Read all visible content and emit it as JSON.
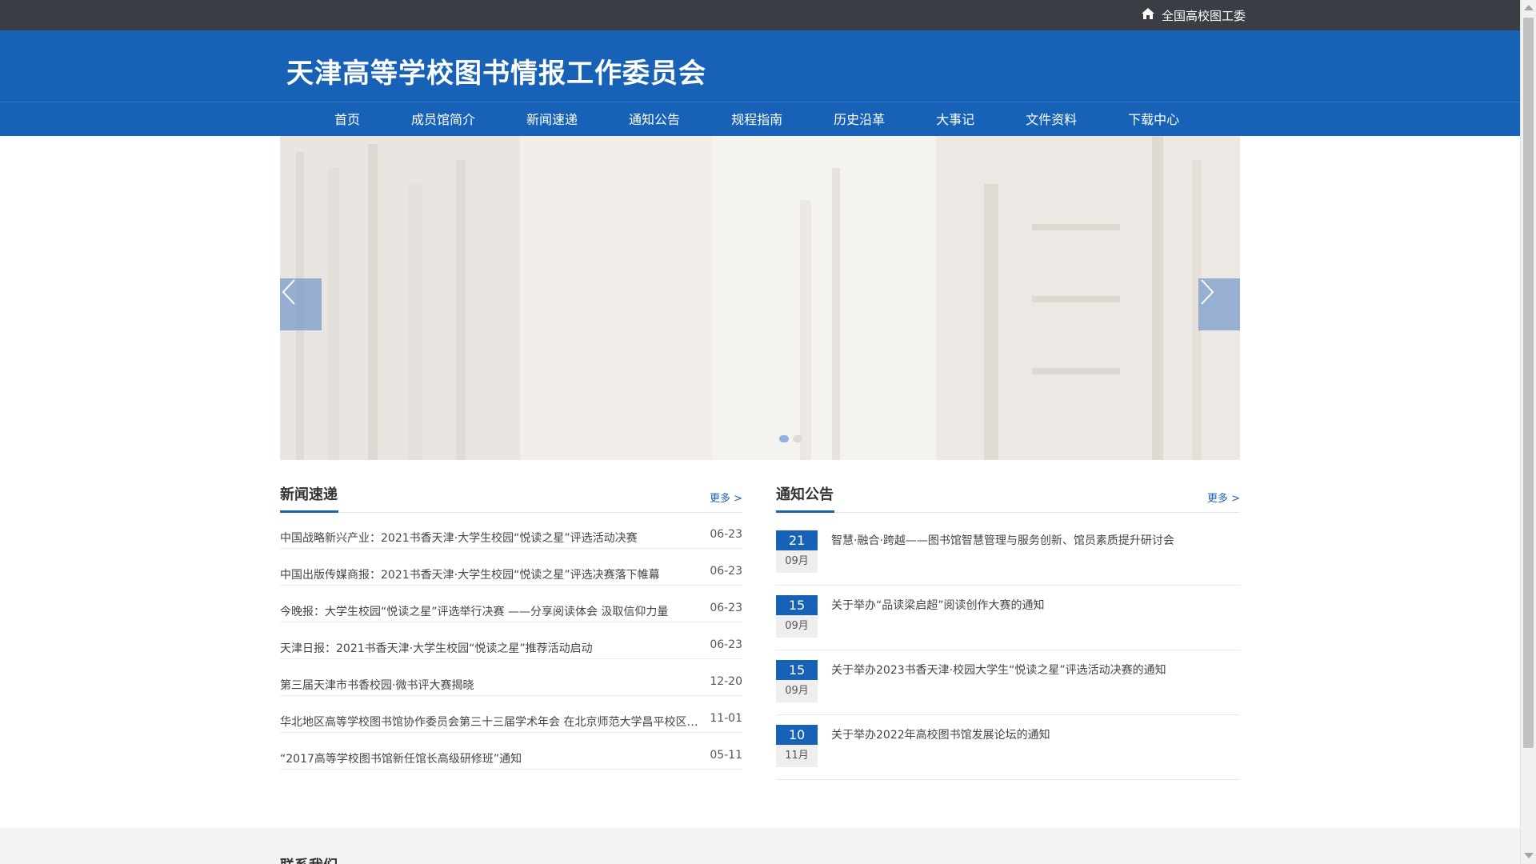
{
  "topbar": {
    "link_label": "全国高校图工委",
    "icon": "home-icon"
  },
  "header": {
    "site_title": "天津高等学校图书情报工作委员会"
  },
  "nav": {
    "items": [
      "首页",
      "成员馆简介",
      "新闻速递",
      "通知公告",
      "规程指南",
      "历史沿革",
      "大事记",
      "文件资料",
      "下载中心"
    ]
  },
  "banner": {
    "slide_count": 2,
    "active_index": 0,
    "prev_icon": "chevron-left-icon",
    "next_icon": "chevron-right-icon"
  },
  "news": {
    "title": "新闻速递",
    "more": "更多 >",
    "items": [
      {
        "title": "中国战略新兴产业：2021书香天津·大学生校园“悦读之星”评选活动决赛",
        "date": "06-23"
      },
      {
        "title": "中国出版传媒商报：2021书香天津·大学生校园“悦读之星”评选决赛落下帷幕",
        "date": "06-23"
      },
      {
        "title": "今晚报：大学生校园“悦读之星”评选举行决赛 ——分享阅读体会 汲取信仰力量",
        "date": "06-23"
      },
      {
        "title": "天津日报：2021书香天津·大学生校园“悦读之星”推荐活动启动",
        "date": "06-23"
      },
      {
        "title": "第三届天津市书香校园·微书评大赛揭晓",
        "date": "12-20"
      },
      {
        "title": "华北地区高等学校图书馆协作委员会第三十三届学术年会 在北京师范大学昌平校区召开",
        "date": "11-01"
      },
      {
        "title": "“2017高等学校图书馆新任馆长高级研修班”通知",
        "date": "05-11"
      }
    ]
  },
  "notices": {
    "title": "通知公告",
    "more": "更多 >",
    "items": [
      {
        "day": "21",
        "month": "09月",
        "title": "智慧·融合·跨越——图书馆智慧管理与服务创新、馆员素质提升研讨会"
      },
      {
        "day": "15",
        "month": "09月",
        "title": "关于举办“品读梁启超”阅读创作大赛的通知"
      },
      {
        "day": "15",
        "month": "09月",
        "title": "关于举办2023书香天津·校园大学生“悦读之星”评选活动决赛的通知"
      },
      {
        "day": "10",
        "month": "11月",
        "title": "关于举办2022年高校图书馆发展论坛的通知"
      }
    ]
  },
  "footer": {
    "title": "联系我们"
  },
  "colors": {
    "brand": "#1761b6",
    "topbar": "#3a3e44"
  }
}
